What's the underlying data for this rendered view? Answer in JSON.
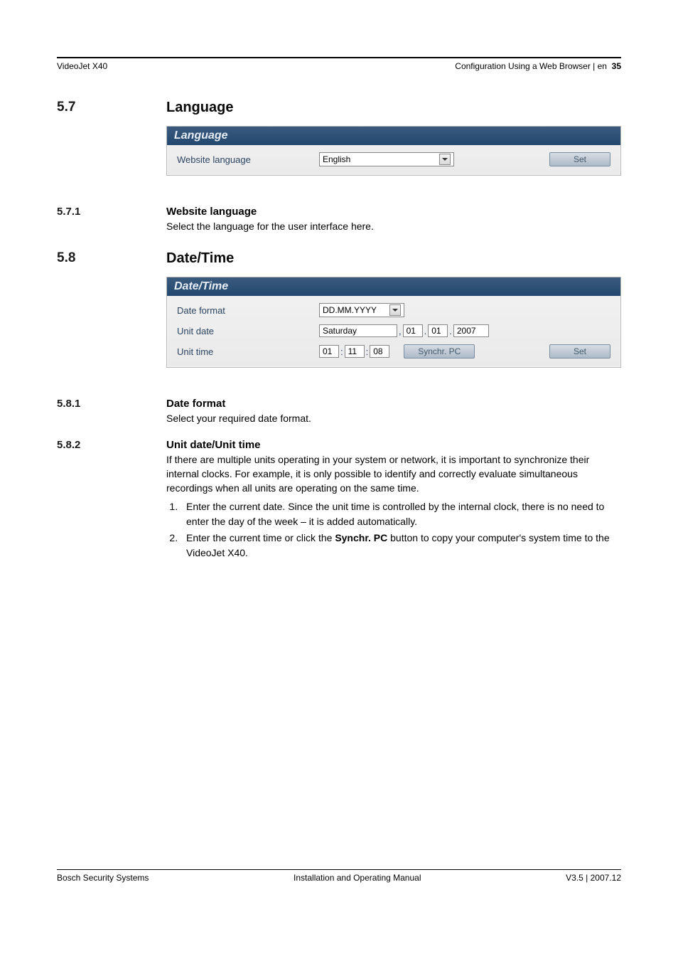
{
  "header": {
    "left": "VideoJet X40",
    "right_label": "Configuration Using a Web Browser | en",
    "page_number": "35"
  },
  "sections": {
    "s57": {
      "num": "5.7",
      "title": "Language",
      "panel": {
        "title": "Language",
        "field_label": "Website language",
        "field_value": "English",
        "set_label": "Set"
      }
    },
    "s571": {
      "num": "5.7.1",
      "title": "Website language",
      "text": "Select the language for the user interface here."
    },
    "s58": {
      "num": "5.8",
      "title": "Date/Time",
      "panel": {
        "title": "Date/Time",
        "date_format_label": "Date format",
        "date_format_value": "DD.MM.YYYY",
        "unit_date_label": "Unit date",
        "unit_date_day": "Saturday",
        "unit_date_d": "01",
        "unit_date_m": "01",
        "unit_date_y": "2007",
        "unit_time_label": "Unit time",
        "unit_time_h": "01",
        "unit_time_m": "11",
        "unit_time_s": "08",
        "synchr_label": "Synchr. PC",
        "set_label": "Set"
      }
    },
    "s581": {
      "num": "5.8.1",
      "title": "Date format",
      "text": "Select your required date format."
    },
    "s582": {
      "num": "5.8.2",
      "title": "Unit date/Unit time",
      "para": "If there are multiple units operating in your system or network, it is important to synchronize their internal clocks. For example, it is only possible to identify and correctly evaluate simultaneous recordings when all units are operating on the same time.",
      "step1": "Enter the current date. Since the unit time is controlled by the internal clock, there is no need to enter the day of the week – it is added automatically.",
      "step2_a": "Enter the current time or click the ",
      "step2_bold": "Synchr. PC",
      "step2_b": " button to copy your computer's system time to the VideoJet X40."
    }
  },
  "footer": {
    "left": "Bosch Security Systems",
    "center": "Installation and Operating Manual",
    "right": "V3.5 | 2007.12"
  }
}
